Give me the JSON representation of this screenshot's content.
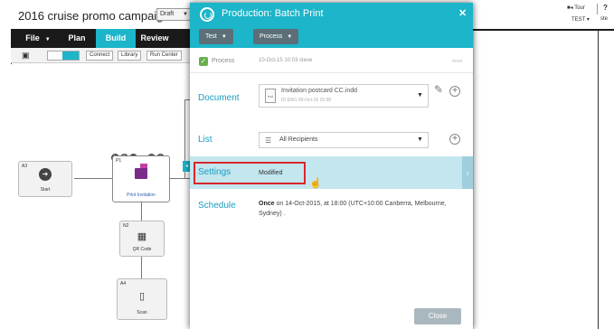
{
  "campaign": {
    "title": "2016 cruise promo campaign",
    "status": "Draft"
  },
  "top_right": {
    "tour": "Tour",
    "test": "TEST",
    "user": "ste"
  },
  "nav": {
    "file": "File",
    "plan": "Plan",
    "build": "Build",
    "review": "Review"
  },
  "toolbar": {
    "connect": "Connect",
    "library": "Library",
    "run_center": "Run Center"
  },
  "nodes": {
    "start": {
      "id": "A3",
      "label": "Start"
    },
    "print": {
      "id": "P1",
      "label": "Print Invitation"
    },
    "qr": {
      "id": "N2",
      "label": "QR Code"
    },
    "scan": {
      "id": "A4",
      "label": "Scan"
    }
  },
  "dialog": {
    "title": "Production: Batch Print",
    "tabs": {
      "test": "Test",
      "process": "Process"
    },
    "process": {
      "label": "Process",
      "date": "10-Oct-15 10:03 steve",
      "more": "more"
    },
    "document": {
      "label": "Document",
      "file_name": "Invitation postcard CC.indd",
      "file_meta": "ID 6061    09-Oct-15 15:58",
      "file_type": "ind"
    },
    "list": {
      "label": "List",
      "value": "All Recipients"
    },
    "settings": {
      "label": "Settings",
      "value": "Modified"
    },
    "schedule": {
      "label": "Schedule",
      "prefix": "Once",
      "text": " on 14-Oct-2015, at 18:00 (UTC+10:00 Canberra, Melbourne, Sydney) ."
    },
    "close_button": "Close"
  },
  "colors": {
    "accent": "#1cb5c9",
    "highlight": "#d9262b",
    "label_blue": "#1b9dc1",
    "nav_bg": "#1a1a1a"
  }
}
